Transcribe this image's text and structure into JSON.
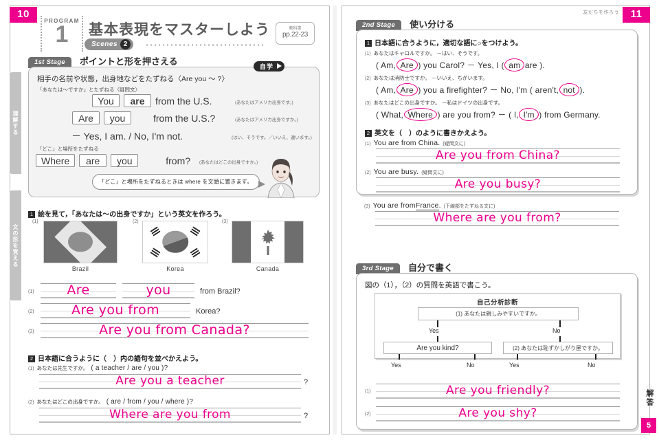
{
  "left_page": {
    "page_number": "10",
    "program_word": "PROGRAM",
    "program_number": "1",
    "title": "基本表現をマスターしよう",
    "scenes_label": "Scenes",
    "scenes_number": "2",
    "textbook_label": "教科書",
    "textbook_pages": "pp.22-23",
    "stage_tab": "1st Stage",
    "stage_title": "ポイントと形を押さえる",
    "jigaku_badge": "自学",
    "side_tabs": [
      "理解する",
      "文の形を覚える"
    ],
    "grammar": {
      "heading": "相手の名前や状態，出身地などをたずねる〈Are you ～ ?〉",
      "sub1": "「あなたは～ですか」とたずねる〈疑問文〉",
      "row1": {
        "chips": [
          "You",
          "are"
        ],
        "tail": "from the U.S.",
        "note": "(あなたはアメリカ出身です。)"
      },
      "row2": {
        "chips": [
          "Are",
          "you"
        ],
        "tail": "from the U.S.?",
        "note": "(あなたはアメリカ出身ですか。)"
      },
      "row3": {
        "text": "－ Yes, I am. / No, I'm not.",
        "note": "(はい、そうです。／いいえ、違います。)"
      },
      "sub2": "「どこ」と場所をたずねる",
      "row4": {
        "chips": [
          "Where",
          "are",
          "you"
        ],
        "tail": "from?",
        "note": "(あなたはどこの出身ですか。)"
      },
      "bubble": "「どこ」と場所をたずねるときは where を文頭に置きます。"
    },
    "exercise1": {
      "number": "1",
      "prompt": "絵を見て，「あなたは～の出身ですか」という英文を作ろう。",
      "flags": [
        {
          "index": "(1)",
          "caption": "Brazil",
          "icon": "brazil-flag"
        },
        {
          "index": "(2)",
          "caption": "Korea",
          "icon": "korea-flag"
        },
        {
          "index": "(3)",
          "caption": "Canada",
          "icon": "canada-flag"
        }
      ],
      "answers": [
        {
          "index": "(1)",
          "parts": [
            "Are",
            "you"
          ],
          "tail": "from Brazil?"
        },
        {
          "index": "(2)",
          "parts": [
            "Are you from"
          ],
          "tail": "Korea?"
        },
        {
          "index": "(3)",
          "parts": [
            "Are you from Canada?"
          ],
          "tail": ""
        }
      ]
    },
    "exercise2": {
      "number": "2",
      "prompt": "日本語に合うように（　）内の語句を並べかえよう。",
      "items": [
        {
          "index": "(1)",
          "jp": "あなたは先生ですか。",
          "choices": "( a teacher / are / you )?",
          "answer": "Are you a teacher",
          "tail": "?"
        },
        {
          "index": "(2)",
          "jp": "あなたはどこの出身ですか。",
          "choices": "( are / from / you / where )?",
          "answer": "Where are you from",
          "tail": "?"
        }
      ]
    }
  },
  "right_page": {
    "page_number": "11",
    "corner_theme": "友だちを作ろう",
    "stage2_tab": "2nd Stage",
    "stage2_title": "使い分ける",
    "stage3_tab": "3rd Stage",
    "stage3_title": "自分で書く",
    "exercise1": {
      "number": "1",
      "prompt": "日本語に合うように，適切な語に○をつけよう。",
      "items": [
        {
          "index": "(1)",
          "jp": "あなたはキャロルですか。 －はい、そうです。",
          "segments": [
            {
              "t": "( Am, ",
              "circle": false
            },
            {
              "t": "Are",
              "circle": true
            },
            {
              "t": " ) you Carol? － Yes, I ( ",
              "circle": false
            },
            {
              "t": "am",
              "circle": true
            },
            {
              "t": " are ).",
              "circle": false
            }
          ]
        },
        {
          "index": "(2)",
          "jp": "あなたは消防士ですか。 －いいえ、ちがいます。",
          "segments": [
            {
              "t": "( Am, ",
              "circle": false
            },
            {
              "t": "Are",
              "circle": true
            },
            {
              "t": " ) you a firefighter? － No, I'm ( aren't, ",
              "circle": false
            },
            {
              "t": "not",
              "circle": true
            },
            {
              "t": " ).",
              "circle": false
            }
          ]
        },
        {
          "index": "(3)",
          "jp": "あなたはどこの出身ですか。 －私はドイツの出身です。",
          "segments": [
            {
              "t": "( What, ",
              "circle": false
            },
            {
              "t": "Where",
              "circle": true
            },
            {
              "t": " ) are you from? － ( I, ",
              "circle": false
            },
            {
              "t": "I'm",
              "circle": true
            },
            {
              "t": " ) from Germany.",
              "circle": false
            }
          ]
        }
      ]
    },
    "exercise2": {
      "number": "2",
      "prompt": "英文を（　）のように書きかえよう。",
      "items": [
        {
          "index": "(1)",
          "source": "You are from China.",
          "hint": "(疑問文に)",
          "answer": "Are you from China?"
        },
        {
          "index": "(2)",
          "source": "You are busy.",
          "hint": "(疑問文に)",
          "answer": "Are you busy?"
        },
        {
          "index": "(3)",
          "source_pre": "You are from ",
          "source_underline": "France",
          "source_post": ".",
          "hint": "(下線部をたずねる文に)",
          "answer": "Where are you from?"
        }
      ]
    },
    "exercise3": {
      "prompt": "図の（1），（2）の質問を英語で書こう。",
      "chart_title": "自己分析診断",
      "root_box": "(1) あなたは親しみやすいですか。",
      "branch_yes": "Yes",
      "branch_no": "No",
      "left_box": "Are you kind?",
      "right_box": "(2) あなたは恥ずかしがり屋ですか。",
      "leaf_labels": [
        "Yes",
        "No",
        "Yes",
        "No"
      ],
      "answers": [
        {
          "index": "(1)",
          "answer": "Are you friendly?"
        },
        {
          "index": "(2)",
          "answer": "Are you shy?"
        }
      ]
    },
    "answer_key_label": "解答",
    "answer_key_number": "5"
  },
  "colors": {
    "accent": "#ec008c",
    "tab_grey": "#6e6e6e",
    "ink": "#2f2f2f"
  }
}
